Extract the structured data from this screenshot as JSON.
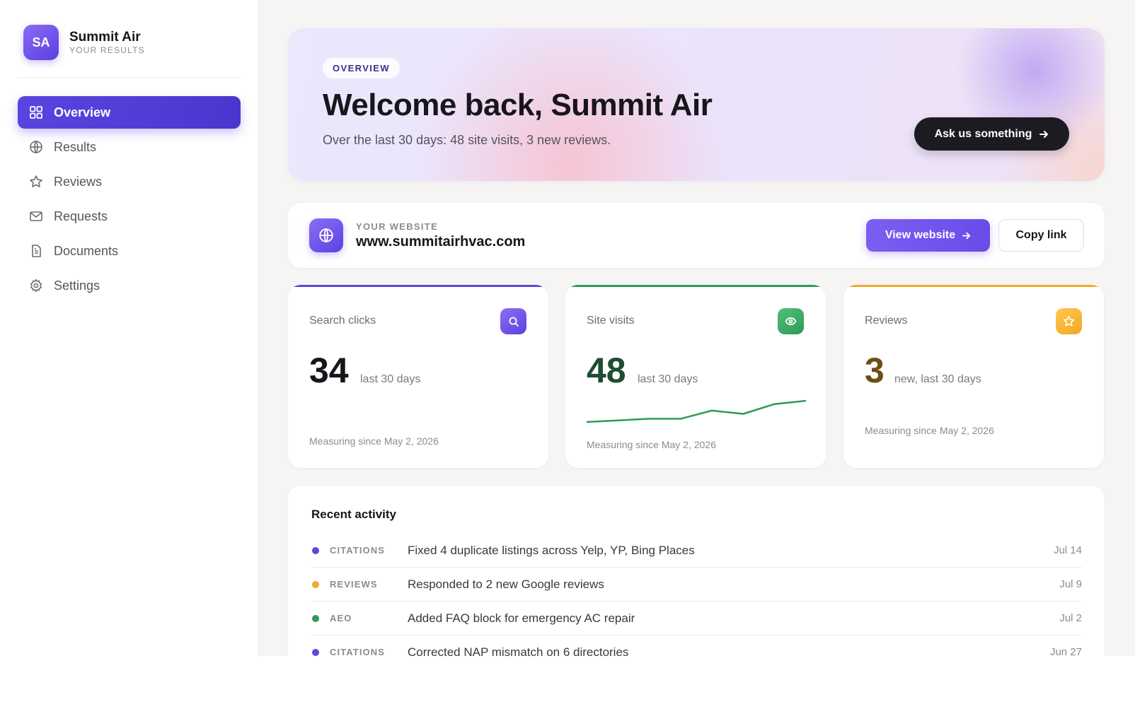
{
  "brand": {
    "initials": "SA",
    "name": "Summit Air",
    "subtitle": "YOUR RESULTS"
  },
  "nav": {
    "items": [
      {
        "label": "Overview",
        "icon": "grid-icon",
        "active": true
      },
      {
        "label": "Results",
        "icon": "globe-icon",
        "active": false
      },
      {
        "label": "Reviews",
        "icon": "star-icon",
        "active": false
      },
      {
        "label": "Requests",
        "icon": "mail-icon",
        "active": false
      },
      {
        "label": "Documents",
        "icon": "document-icon",
        "active": false
      },
      {
        "label": "Settings",
        "icon": "gear-icon",
        "active": false
      }
    ]
  },
  "hero": {
    "pill": "OVERVIEW",
    "title": "Welcome back, Summit Air",
    "subtitle": "Over the last 30 days: 48 site visits, 3 new reviews.",
    "cta_label": "Ask us something"
  },
  "website": {
    "label": "YOUR WEBSITE",
    "url": "www.summitairhvac.com",
    "view_label": "View website",
    "copy_label": "Copy link"
  },
  "stats": [
    {
      "label": "Search clicks",
      "value": "34",
      "unit": "last 30 days",
      "since": "Measuring since May 2, 2026",
      "icon": "search-icon",
      "accent": "#5a48d6"
    },
    {
      "label": "Site visits",
      "value": "48",
      "unit": "last 30 days",
      "since": "Measuring since May 2, 2026",
      "icon": "eye-icon",
      "accent": "#2f9a55",
      "sparkline": [
        3,
        4,
        5,
        5,
        10,
        8,
        14,
        16
      ]
    },
    {
      "label": "Reviews",
      "value": "3",
      "unit": "new, last 30 days",
      "since": "Measuring since May 2, 2026",
      "icon": "star-icon",
      "accent": "#f0a92c"
    }
  ],
  "activity": {
    "title": "Recent activity",
    "rows": [
      {
        "category": "CITATIONS",
        "text": "Fixed 4 duplicate listings across Yelp, YP, Bing Places",
        "date": "Jul 14",
        "color": "#5a48d6"
      },
      {
        "category": "REVIEWS",
        "text": "Responded to 2 new Google reviews",
        "date": "Jul 9",
        "color": "#f0a92c"
      },
      {
        "category": "AEO",
        "text": "Added FAQ block for emergency AC repair",
        "date": "Jul 2",
        "color": "#2f9a55"
      },
      {
        "category": "CITATIONS",
        "text": "Corrected NAP mismatch on 6 directories",
        "date": "Jun 27",
        "color": "#5a48d6"
      }
    ]
  }
}
